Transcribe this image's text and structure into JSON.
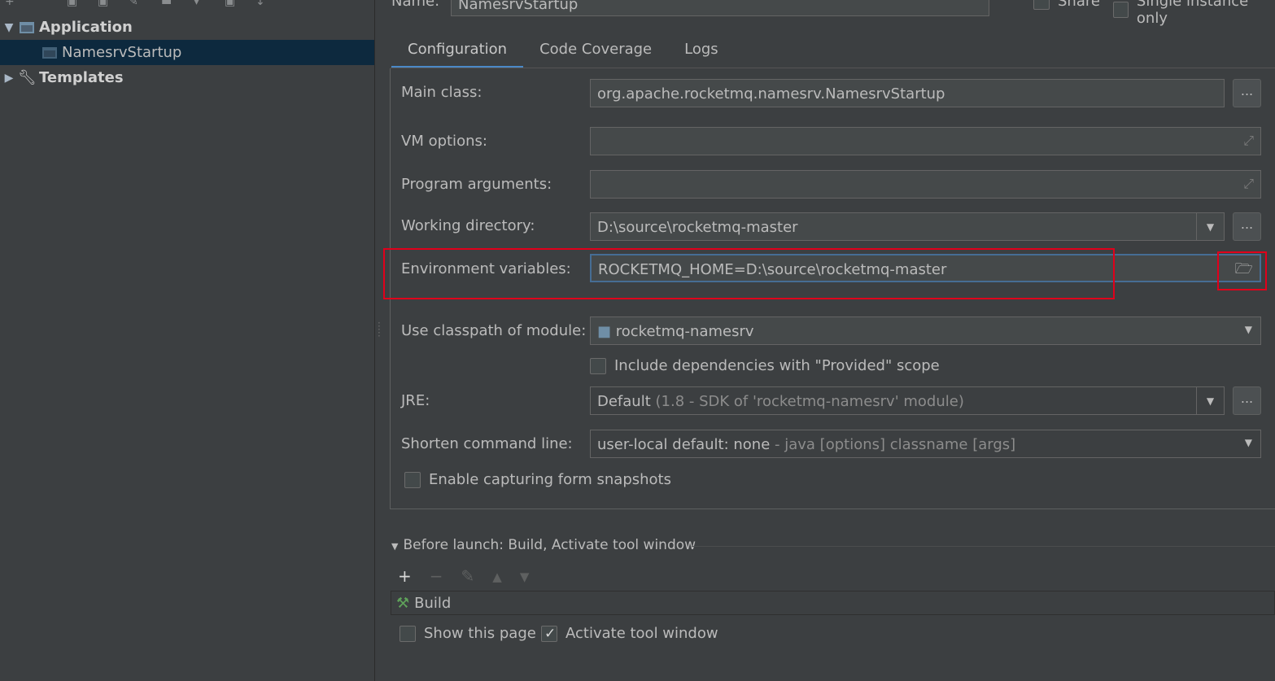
{
  "tree": {
    "application_label": "Application",
    "child_label": "NamesrvStartup",
    "templates_label": "Templates"
  },
  "header": {
    "name_label": "Name:",
    "name_value": "NamesrvStartup",
    "share_label": "Share",
    "single_instance_label": "Single instance only"
  },
  "tabs": [
    {
      "label": "Configuration"
    },
    {
      "label": "Code Coverage"
    },
    {
      "label": "Logs"
    }
  ],
  "form": {
    "main_class": {
      "label": "Main class:",
      "value": "org.apache.rocketmq.namesrv.NamesrvStartup"
    },
    "vm_options": {
      "label": "VM options:",
      "value": ""
    },
    "program_arguments": {
      "label": "Program arguments:",
      "value": ""
    },
    "working_directory": {
      "label": "Working directory:",
      "value": "D:\\source\\rocketmq-master"
    },
    "environment_variables": {
      "label": "Environment variables:",
      "value": "ROCKETMQ_HOME=D:\\source\\rocketmq-master"
    },
    "classpath_module": {
      "label": "Use classpath of module:",
      "value": "rocketmq-namesrv"
    },
    "include_provided": {
      "label": "Include dependencies with \"Provided\" scope",
      "checked": false
    },
    "jre": {
      "label": "JRE:",
      "value": "Default",
      "hint": "(1.8 - SDK of 'rocketmq-namesrv' module)"
    },
    "shorten_cmd": {
      "label": "Shorten command line:",
      "value": "user-local default: none",
      "hint": "- java [options] classname [args]"
    },
    "snapshots": {
      "label": "Enable capturing form snapshots",
      "checked": false
    },
    "dots": "..."
  },
  "before_launch": {
    "title": "Before launch: Build, Activate tool window",
    "items": [
      {
        "label": "Build"
      }
    ],
    "show_page": {
      "label": "Show this page",
      "checked": false
    },
    "activate_tool": {
      "label": "Activate tool window",
      "checked": true
    }
  },
  "colors": {
    "background": "#3c3f41",
    "selection": "#0d293e",
    "highlight_box": "#e0001b",
    "tab_underline": "#4a88c7"
  }
}
